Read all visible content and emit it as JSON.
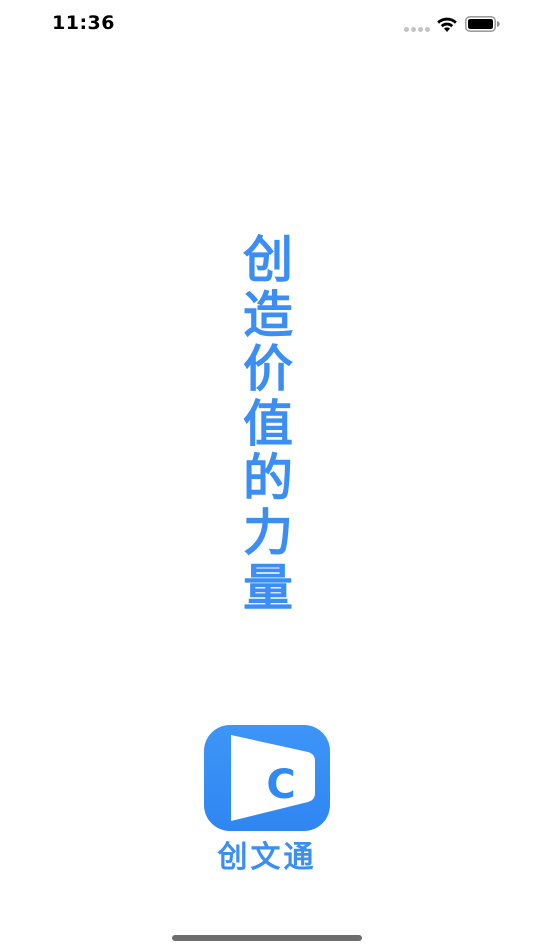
{
  "status_bar": {
    "time": "11:36",
    "icons": [
      "signal-dots-icon",
      "wifi-icon",
      "battery-icon"
    ]
  },
  "slogan": {
    "chars": [
      "创",
      "造",
      "价",
      "值",
      "的",
      "力",
      "量"
    ]
  },
  "app": {
    "logo_letter": "C",
    "name": "创文通"
  },
  "colors": {
    "brand_blue": "#3b8ff4",
    "background": "#ffffff"
  }
}
